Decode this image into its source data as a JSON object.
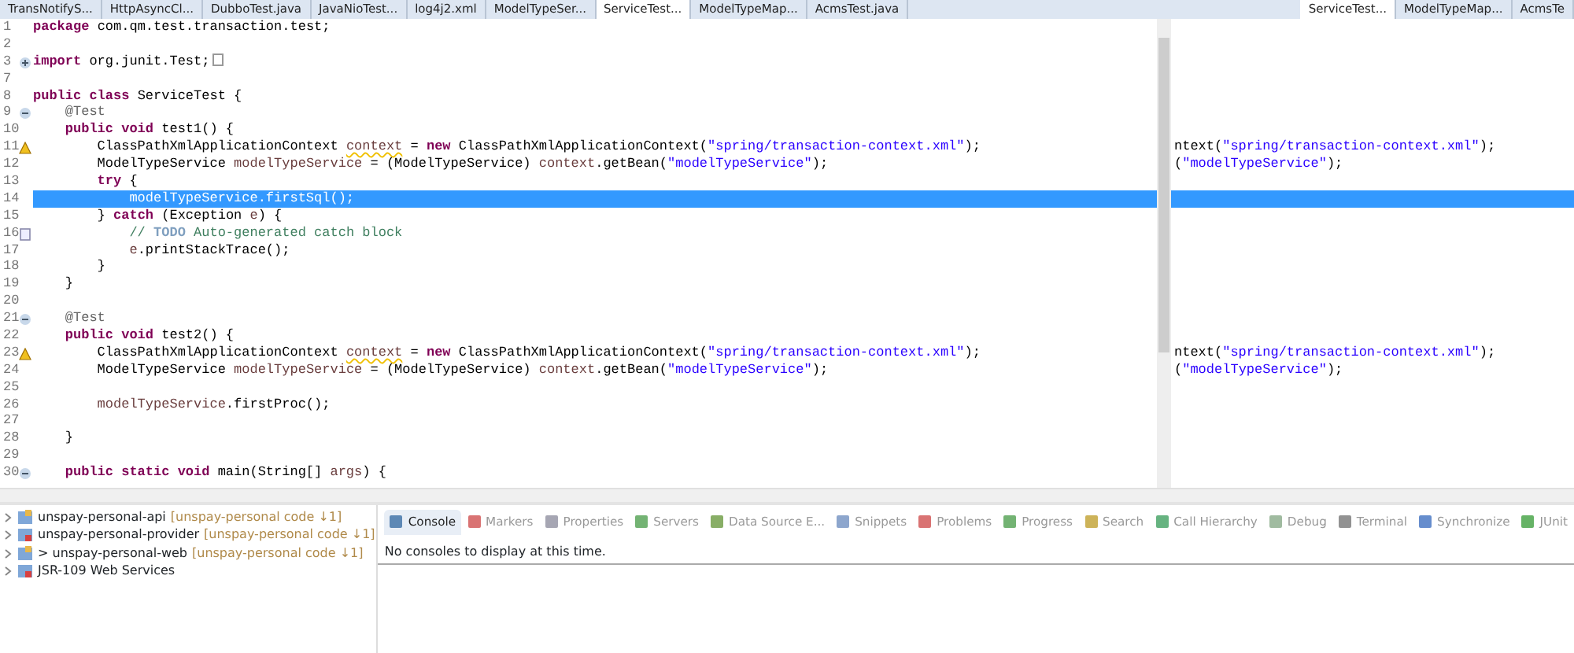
{
  "editor_tabs": {
    "left": [
      {
        "label": "TransNotifyS...",
        "selected": false
      },
      {
        "label": "HttpAsyncCl...",
        "selected": false
      },
      {
        "label": "DubboTest.java",
        "selected": false
      },
      {
        "label": "JavaNioTest...",
        "selected": false
      },
      {
        "label": "log4j2.xml",
        "selected": false
      },
      {
        "label": "ModelTypeSer...",
        "selected": false
      },
      {
        "label": "ServiceTest...",
        "selected": true
      },
      {
        "label": "ModelTypeMap...",
        "selected": false
      },
      {
        "label": "AcmsTest.java",
        "selected": false
      }
    ],
    "right": [
      {
        "label": "ServiceTest...",
        "selected": true
      },
      {
        "label": "ModelTypeMap...",
        "selected": false
      },
      {
        "label": "AcmsTe",
        "selected": false
      }
    ]
  },
  "code_lines": [
    {
      "number": "1",
      "selected": false,
      "segments": [
        {
          "kind": "keyword",
          "text": "package"
        },
        {
          "kind": "plain",
          "text": " com.qm.test.transaction.test;"
        }
      ]
    },
    {
      "number": "2",
      "selected": false
    },
    {
      "number": "3",
      "kind": "expand",
      "selected": false,
      "folded": true,
      "segments": [
        {
          "kind": "keyword",
          "text": "import"
        },
        {
          "kind": "plain",
          "text": " org.junit.Test;"
        }
      ]
    },
    {
      "number": "7",
      "selected": false
    },
    {
      "number": "8",
      "selected": false,
      "segments": [
        {
          "kind": "keyword",
          "text": "public class"
        },
        {
          "kind": "plain",
          "text": " ServiceTest {"
        }
      ]
    },
    {
      "number": "9",
      "kind": "collapse",
      "selected": false,
      "segments": [
        {
          "kind": "annotation",
          "text": "    @Test"
        }
      ]
    },
    {
      "number": "10",
      "selected": false,
      "segments": [
        {
          "kind": "keyword",
          "text": "    public void"
        },
        {
          "kind": "plain",
          "text": " test1() {"
        }
      ]
    },
    {
      "number": "11",
      "kind": "warning",
      "selected": false,
      "segments": [
        {
          "kind": "plain",
          "text": "        ClassPathXmlApplicationContext "
        },
        {
          "kind": "warned",
          "text": "context"
        },
        {
          "kind": "plain",
          "text": " = "
        },
        {
          "kind": "keyword",
          "text": "new"
        },
        {
          "kind": "plain",
          "text": " ClassPathXmlApplicationContext("
        },
        {
          "kind": "string",
          "text": "\"spring/transaction-context.xml\""
        },
        {
          "kind": "plain",
          "text": ");"
        }
      ],
      "overflow": [
        {
          "kind": "plain",
          "text": "ntext("
        },
        {
          "kind": "string",
          "text": "\"spring/transaction-context.xml\""
        },
        {
          "kind": "plain",
          "text": ");"
        }
      ]
    },
    {
      "number": "12",
      "selected": false,
      "segments": [
        {
          "kind": "plain",
          "text": "        ModelTypeService "
        },
        {
          "kind": "local",
          "text": "modelTypeService"
        },
        {
          "kind": "plain",
          "text": " = (ModelTypeService) "
        },
        {
          "kind": "local",
          "text": "context"
        },
        {
          "kind": "plain",
          "text": ".getBean("
        },
        {
          "kind": "string",
          "text": "\"modelTypeService\""
        },
        {
          "kind": "plain",
          "text": ");"
        }
      ],
      "overflow": [
        {
          "kind": "plain",
          "text": "("
        },
        {
          "kind": "string",
          "text": "\"modelTypeService\""
        },
        {
          "kind": "plain",
          "text": ");"
        }
      ]
    },
    {
      "number": "13",
      "selected": false,
      "segments": [
        {
          "kind": "keyword",
          "text": "        try"
        },
        {
          "kind": "plain",
          "text": " {"
        }
      ]
    },
    {
      "number": "14",
      "selected": true,
      "segments": [
        {
          "kind": "plain",
          "text": "            modelTypeService.firstSql();"
        }
      ]
    },
    {
      "number": "15",
      "selected": false,
      "segments": [
        {
          "kind": "plain",
          "text": "        } "
        },
        {
          "kind": "keyword",
          "text": "catch"
        },
        {
          "kind": "plain",
          "text": " (Exception "
        },
        {
          "kind": "local",
          "text": "e"
        },
        {
          "kind": "plain",
          "text": ") {"
        }
      ]
    },
    {
      "number": "16",
      "kind": "task",
      "selected": false,
      "segments": [
        {
          "kind": "comment",
          "text": "            // "
        },
        {
          "kind": "todo",
          "text": "TODO"
        },
        {
          "kind": "comment",
          "text": " Auto-generated catch block"
        }
      ]
    },
    {
      "number": "17",
      "selected": false,
      "segments": [
        {
          "kind": "local",
          "text": "            e"
        },
        {
          "kind": "plain",
          "text": ".printStackTrace();"
        }
      ]
    },
    {
      "number": "18",
      "selected": false,
      "segments": [
        {
          "kind": "plain",
          "text": "        }"
        }
      ]
    },
    {
      "number": "19",
      "selected": false,
      "segments": [
        {
          "kind": "plain",
          "text": "    }"
        }
      ]
    },
    {
      "number": "20",
      "selected": false
    },
    {
      "number": "21",
      "kind": "collapse",
      "selected": false,
      "segments": [
        {
          "kind": "annotation",
          "text": "    @Test"
        }
      ]
    },
    {
      "number": "22",
      "selected": false,
      "segments": [
        {
          "kind": "keyword",
          "text": "    public void"
        },
        {
          "kind": "plain",
          "text": " test2() {"
        }
      ]
    },
    {
      "number": "23",
      "kind": "warning",
      "selected": false,
      "segments": [
        {
          "kind": "plain",
          "text": "        ClassPathXmlApplicationContext "
        },
        {
          "kind": "warned",
          "text": "context"
        },
        {
          "kind": "plain",
          "text": " = "
        },
        {
          "kind": "keyword",
          "text": "new"
        },
        {
          "kind": "plain",
          "text": " ClassPathXmlApplicationContext("
        },
        {
          "kind": "string",
          "text": "\"spring/transaction-context.xml\""
        },
        {
          "kind": "plain",
          "text": ");"
        }
      ],
      "overflow": [
        {
          "kind": "plain",
          "text": "ntext("
        },
        {
          "kind": "string",
          "text": "\"spring/transaction-context.xml\""
        },
        {
          "kind": "plain",
          "text": ");"
        }
      ]
    },
    {
      "number": "24",
      "selected": false,
      "segments": [
        {
          "kind": "plain",
          "text": "        ModelTypeService "
        },
        {
          "kind": "local",
          "text": "modelTypeService"
        },
        {
          "kind": "plain",
          "text": " = (ModelTypeService) "
        },
        {
          "kind": "local",
          "text": "context"
        },
        {
          "kind": "plain",
          "text": ".getBean("
        },
        {
          "kind": "string",
          "text": "\"modelTypeService\""
        },
        {
          "kind": "plain",
          "text": ");"
        }
      ],
      "overflow": [
        {
          "kind": "plain",
          "text": "("
        },
        {
          "kind": "string",
          "text": "\"modelTypeService\""
        },
        {
          "kind": "plain",
          "text": ");"
        }
      ]
    },
    {
      "number": "25",
      "selected": false
    },
    {
      "number": "26",
      "selected": false,
      "segments": [
        {
          "kind": "local",
          "text": "        modelTypeService"
        },
        {
          "kind": "plain",
          "text": ".firstProc();"
        }
      ]
    },
    {
      "number": "27",
      "selected": false
    },
    {
      "number": "28",
      "selected": false,
      "segments": [
        {
          "kind": "plain",
          "text": "    }"
        }
      ]
    },
    {
      "number": "29",
      "selected": false
    },
    {
      "number": "30",
      "kind": "collapse",
      "selected": false,
      "segments": [
        {
          "kind": "keyword",
          "text": "    public static void"
        },
        {
          "kind": "plain",
          "text": " main(String[] "
        },
        {
          "kind": "local",
          "text": "args"
        },
        {
          "kind": "plain",
          "text": ") {"
        }
      ]
    }
  ],
  "package_explorer": [
    {
      "name": "unspay-personal-api",
      "decoration": "[unspay-personal code ↓1]"
    },
    {
      "name": "unspay-personal-provider",
      "decoration": "[unspay-personal code ↓1]"
    },
    {
      "name": "> unspay-personal-web",
      "decoration": "[unspay-personal code ↓1]"
    },
    {
      "name": "JSR-109 Web Services"
    }
  ],
  "view_tabs": [
    {
      "label": "Console",
      "selected": true
    },
    {
      "label": "Markers",
      "selected": false
    },
    {
      "label": "Properties",
      "selected": false
    },
    {
      "label": "Servers",
      "selected": false
    },
    {
      "label": "Data Source E...",
      "selected": false
    },
    {
      "label": "Snippets",
      "selected": false
    },
    {
      "label": "Problems",
      "selected": false
    },
    {
      "label": "Progress",
      "selected": false
    },
    {
      "label": "Search",
      "selected": false
    },
    {
      "label": "Call Hierarchy",
      "selected": false
    },
    {
      "label": "Debug",
      "selected": false
    },
    {
      "label": "Terminal",
      "selected": false
    },
    {
      "label": "Synchronize",
      "selected": false
    },
    {
      "label": "JUnit",
      "selected": false
    }
  ],
  "console_message": "No consoles to display at this time."
}
